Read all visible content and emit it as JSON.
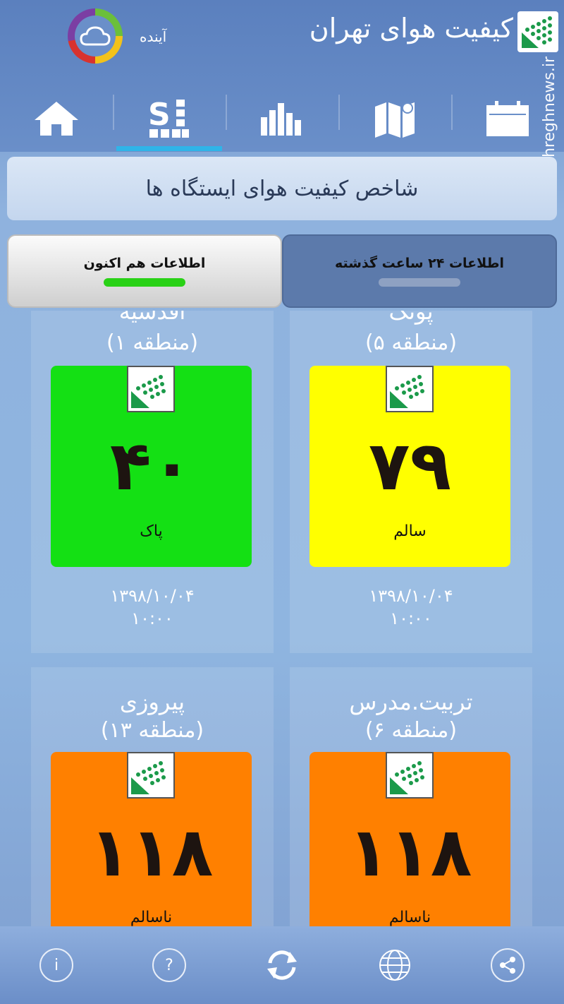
{
  "header": {
    "app_title": "کیفیت هوای تهران",
    "forecast_label": "آینده",
    "watermark": "mashreghnews.ir"
  },
  "nav": {
    "tabs": [
      {
        "name": "home-icon",
        "active": false
      },
      {
        "name": "stations-index-icon",
        "active": true
      },
      {
        "name": "bar-chart-icon",
        "active": false
      },
      {
        "name": "map-icon",
        "active": false
      },
      {
        "name": "calendar-icon",
        "active": false
      }
    ]
  },
  "title_bar": {
    "text": "شاخص کیفیت هوای ایستگاه ها"
  },
  "data_tabs": {
    "current_label": "اطلاعات هم اکنون",
    "past_label": "اطلاعات ۲۴ ساعت گذشته"
  },
  "stations": [
    {
      "name": "اقدسیه",
      "region": "(منطقه ۱)",
      "aqi": "۴۰",
      "status": "پاک",
      "color": "#14e014",
      "date": "۱۳۹۸/۱۰/۰۴",
      "time": "۱۰:۰۰"
    },
    {
      "name": "پونک",
      "region": "(منطقه ۵)",
      "aqi": "۷۹",
      "status": "سالم",
      "color": "#ffff00",
      "date": "۱۳۹۸/۱۰/۰۴",
      "time": "۱۰:۰۰"
    },
    {
      "name": "پیروزی",
      "region": "(منطقه ۱۳)",
      "aqi": "۱۱۸",
      "status": "ناسالم",
      "color": "#ff8000",
      "date": "",
      "time": ""
    },
    {
      "name": "تربیت.مدرس",
      "region": "(منطقه ۶)",
      "aqi": "۱۱۸",
      "status": "ناسالم",
      "color": "#ff8000",
      "date": "",
      "time": ""
    }
  ],
  "bottom_bar": {
    "buttons": [
      "info-icon",
      "help-icon",
      "refresh-icon",
      "globe-icon",
      "share-icon"
    ]
  },
  "colors": {
    "header_bg": "#6a8fc9",
    "active_tab_underline": "#2fb4e8",
    "current_indicator": "#29d116"
  }
}
